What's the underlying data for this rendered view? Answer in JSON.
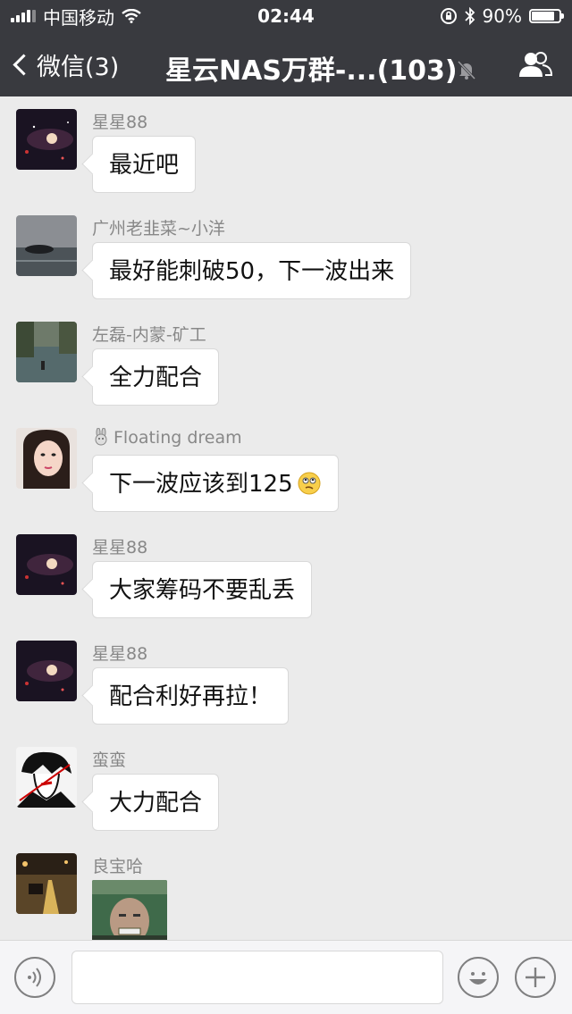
{
  "status_bar": {
    "carrier": "中国移动",
    "time": "02:44",
    "battery_text": "90%",
    "battery_level": 0.9
  },
  "nav": {
    "back_label": "微信(3)",
    "title": "星云NAS万群-...(103)",
    "muted": true
  },
  "messages": [
    {
      "sender": "星星88",
      "text": "最近吧",
      "avatar": "galaxy"
    },
    {
      "sender": "广州老韭菜~小洋",
      "text": "最好能刺破50，下一波出来",
      "avatar": "seascape"
    },
    {
      "sender": "左磊-内蒙-矿工",
      "text": "全力配合",
      "avatar": "river"
    },
    {
      "sender_prefix_icon": "rabbit-icon",
      "sender": "Floating dream",
      "text": "下一波应该到125",
      "emoji": "thinking-emoji",
      "avatar": "portrait"
    },
    {
      "sender": "星星88",
      "text": "大家筹码不要乱丢",
      "avatar": "galaxy"
    },
    {
      "sender": "星星88",
      "text": "配合利好再拉！",
      "avatar": "galaxy"
    },
    {
      "sender": "蛮蛮",
      "text": "大力配合",
      "avatar": "anime"
    },
    {
      "sender": "良宝哈",
      "text": "",
      "sticker": "grinning-man-sticker",
      "avatar": "street"
    }
  ],
  "input_bar": {
    "value": "",
    "icons": [
      "voice-icon",
      "emoji-icon",
      "plus-icon"
    ]
  },
  "colors": {
    "header_bg": "#393a3f",
    "chat_bg": "#ebebeb",
    "bubble_bg": "#ffffff"
  }
}
